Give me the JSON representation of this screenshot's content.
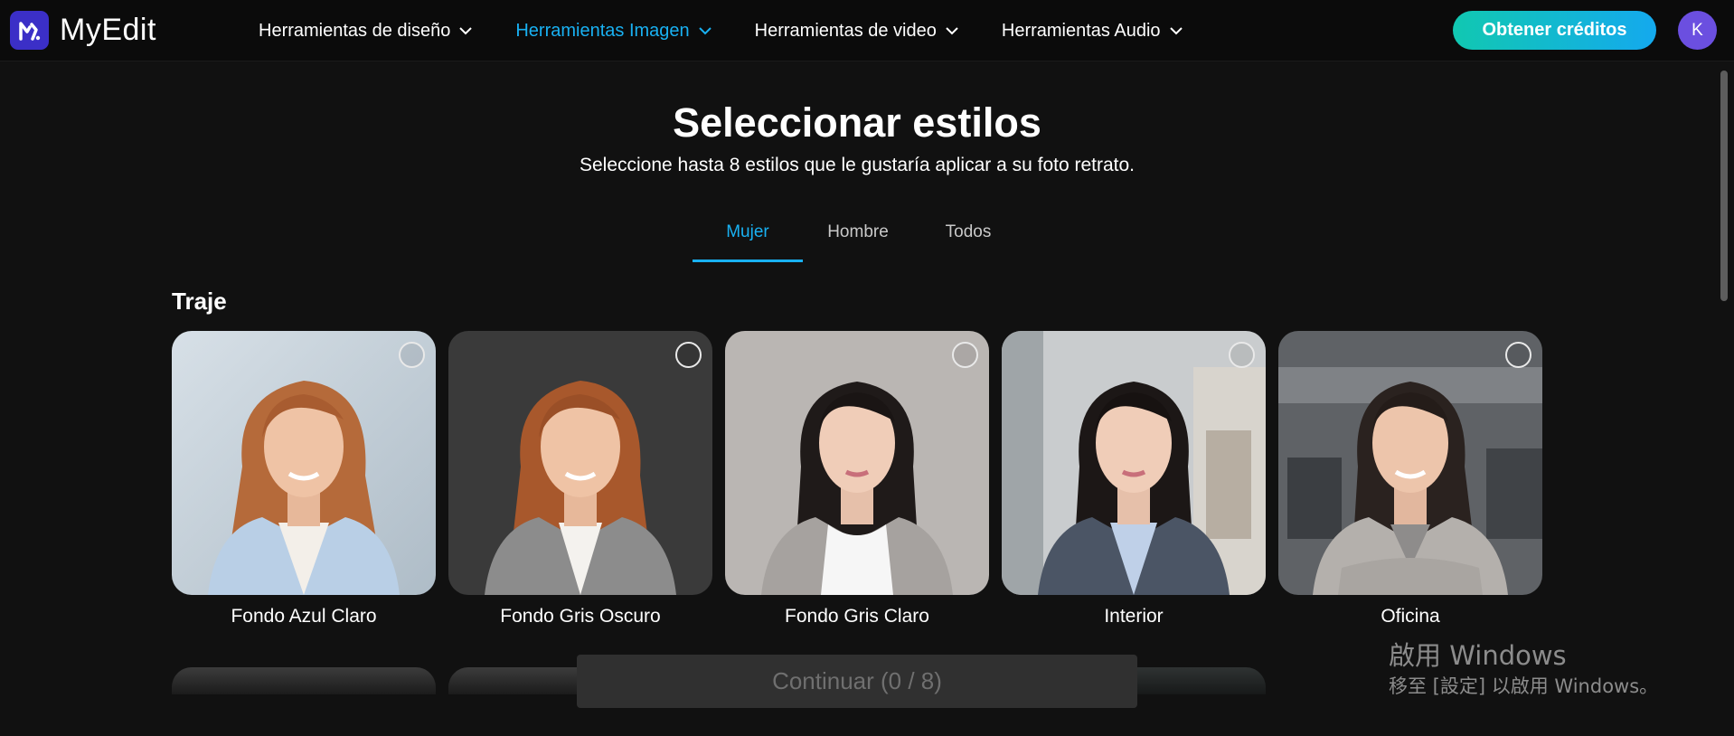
{
  "app": {
    "name": "MyEdit"
  },
  "header": {
    "nav": [
      {
        "label": "Herramientas de diseño",
        "active": false
      },
      {
        "label": "Herramientas Imagen",
        "active": true
      },
      {
        "label": "Herramientas de video",
        "active": false
      },
      {
        "label": "Herramientas Audio",
        "active": false
      }
    ],
    "credits_label": "Obtener créditos",
    "avatar_initial": "K"
  },
  "page": {
    "title": "Seleccionar estilos",
    "subtitle": "Seleccione hasta 8 estilos que le gustaría aplicar a su foto retrato."
  },
  "tabs": [
    {
      "label": "Mujer",
      "active": true
    },
    {
      "label": "Hombre",
      "active": false
    },
    {
      "label": "Todos",
      "active": false
    }
  ],
  "section": {
    "title": "Traje"
  },
  "styles": [
    {
      "label": "Fondo Azul Claro",
      "selected": false
    },
    {
      "label": "Fondo Gris Oscuro",
      "selected": false
    },
    {
      "label": "Fondo Gris Claro",
      "selected": false
    },
    {
      "label": "Interior",
      "selected": false
    },
    {
      "label": "Oficina",
      "selected": false
    }
  ],
  "continue_label": "Continuar (0 / 8)",
  "windows_activation": {
    "line1": "啟用 Windows",
    "line2": "移至 [設定] 以啟用 Windows。"
  },
  "colors": {
    "accent": "#19b1f2",
    "brand": "#3b2fc7",
    "background": "#111111"
  }
}
